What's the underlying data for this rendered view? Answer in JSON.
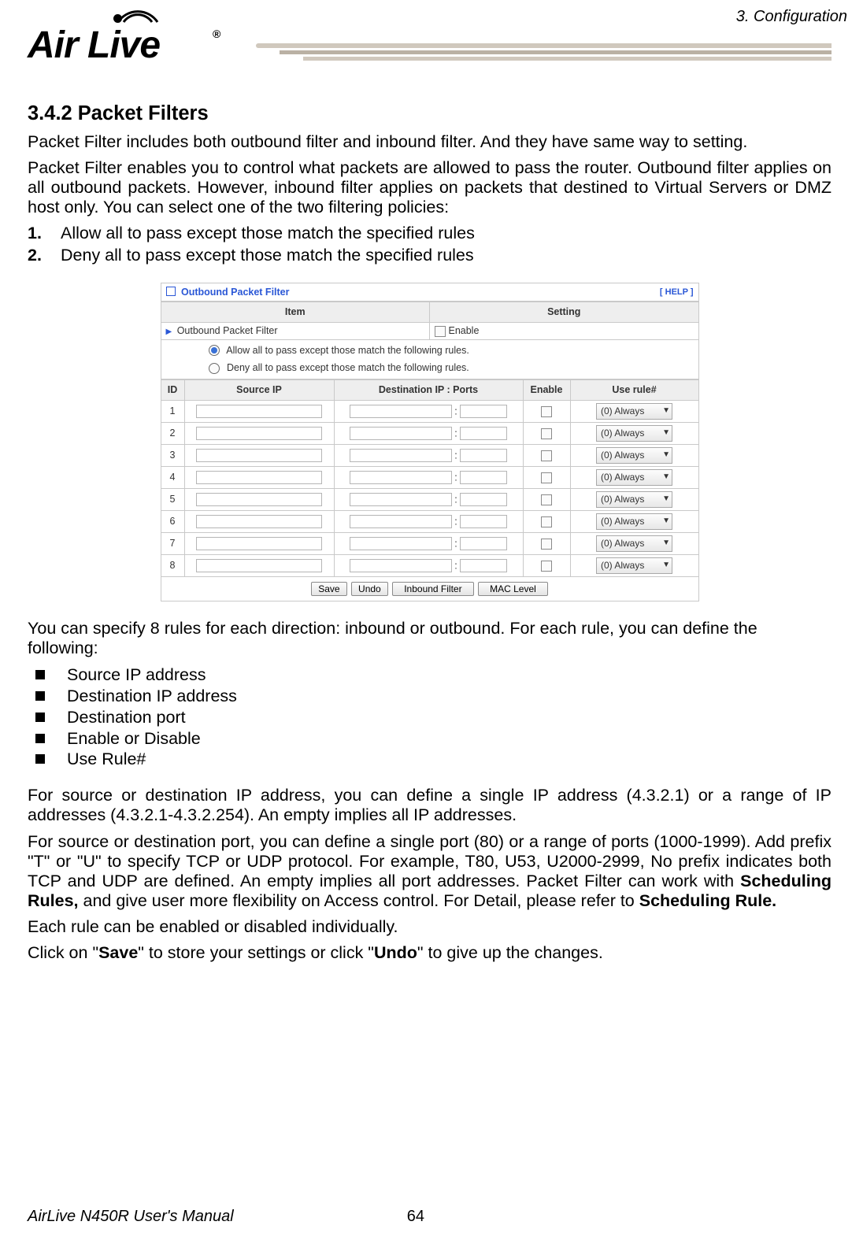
{
  "header": {
    "section_label": "3.  Configuration",
    "logo_text": "Air Live",
    "reg": "®"
  },
  "section": {
    "title": "3.4.2 Packet Filters",
    "p1": "Packet Filter includes both outbound filter and inbound filter. And they have same way to setting.",
    "p2": "Packet Filter enables you to control what packets are allowed to pass the router. Outbound filter applies on all outbound packets. However, inbound filter applies on packets that destined to Virtual Servers or DMZ host only. You can select one of the two filtering policies:",
    "ol1_num": "1.",
    "ol1_text": "Allow all to pass except those match the specified rules",
    "ol2_num": "2.",
    "ol2_text": "Deny all to pass except those match the specified rules",
    "p3": "You can specify 8 rules for each direction: inbound or outbound. For each rule, you can define the following:",
    "b1": "Source IP address",
    "b2": "Destination IP address",
    "b3": "Destination port",
    "b4": "Enable or Disable",
    "b5": "Use Rule#",
    "p4_a": "For source or destination IP address, you can define a single IP address (4.3.2.1) or a range of IP addresses (4.3.2.1-4.3.2.254). An empty implies all IP addresses.",
    "p5_pre": "For source or destination port, you can define a single port (80) or a range of ports (1000-1999). Add prefix \"T\" or \"U\" to specify TCP or UDP protocol. For example, T80, U53, U2000-2999, No prefix indicates both TCP and UDP are defined. An empty implies all port addresses. Packet Filter can work with ",
    "p5_b1": "Scheduling Rules,",
    "p5_mid": " and give user more flexibility on Access control. For Detail, please refer to ",
    "p5_b2": "Scheduling Rule.",
    "p6": "Each rule can be enabled or disabled individually.",
    "p7_a": "Click on \"",
    "p7_b1": "Save",
    "p7_b": "\" to store your settings or click \"",
    "p7_b2": "Undo",
    "p7_c": "\" to give up the changes."
  },
  "shot": {
    "panel_title": "Outbound Packet Filter",
    "help": "[ HELP ]",
    "th_item": "Item",
    "th_setting": "Setting",
    "row_item": "Outbound Packet Filter",
    "row_enable": "Enable",
    "radio_allow": "Allow all to pass except those match the following rules.",
    "radio_deny": "Deny all to pass except those match the following rules.",
    "th_id": "ID",
    "th_src": "Source IP",
    "th_dst": "Destination IP : Ports",
    "th_en": "Enable",
    "th_use": "Use rule#",
    "colon": ":",
    "rule_option": "(0) Always",
    "rows": [
      "1",
      "2",
      "3",
      "4",
      "5",
      "6",
      "7",
      "8"
    ],
    "btn_save": "Save",
    "btn_undo": "Undo",
    "btn_inbound": "Inbound Filter",
    "btn_mac": "MAC Level"
  },
  "footer": {
    "title": "AirLive N450R User's Manual",
    "page": "64"
  }
}
